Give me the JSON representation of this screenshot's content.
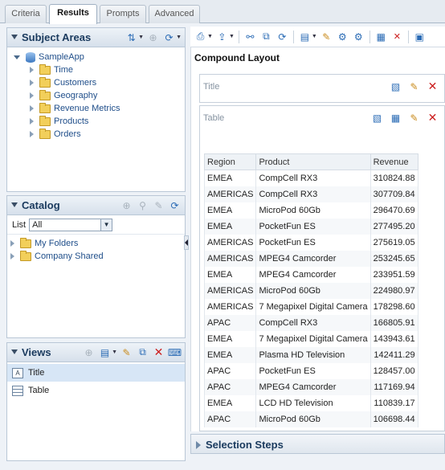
{
  "tabs": [
    {
      "label": "Criteria"
    },
    {
      "label": "Results"
    },
    {
      "label": "Prompts"
    },
    {
      "label": "Advanced"
    }
  ],
  "active_tab": "Results",
  "subject_areas": {
    "title": "Subject Areas",
    "root": "SampleApp",
    "folders": [
      "Time",
      "Customers",
      "Geography",
      "Revenue Metrics",
      "Products",
      "Orders"
    ]
  },
  "catalog": {
    "title": "Catalog",
    "list_label": "List",
    "list_selected": "All",
    "folders": [
      "My Folders",
      "Company Shared"
    ]
  },
  "views": {
    "title": "Views",
    "items": [
      {
        "label": "Title",
        "icon": "title-view-icon"
      },
      {
        "label": "Table",
        "icon": "table-view-icon"
      }
    ]
  },
  "layout": {
    "title": "Compound Layout",
    "title_view_label": "Title",
    "table_view_label": "Table"
  },
  "table": {
    "columns": [
      "Region",
      "Product",
      "Revenue"
    ],
    "rows": [
      [
        "EMEA",
        "CompCell RX3",
        "310824.88"
      ],
      [
        "AMERICAS",
        "CompCell RX3",
        "307709.84"
      ],
      [
        "EMEA",
        "MicroPod 60Gb",
        "296470.69"
      ],
      [
        "EMEA",
        "PocketFun ES",
        "277495.20"
      ],
      [
        "AMERICAS",
        "PocketFun ES",
        "275619.05"
      ],
      [
        "AMERICAS",
        "MPEG4 Camcorder",
        "253245.65"
      ],
      [
        "EMEA",
        "MPEG4 Camcorder",
        "233951.59"
      ],
      [
        "AMERICAS",
        "MicroPod 60Gb",
        "224980.97"
      ],
      [
        "AMERICAS",
        "7 Megapixel Digital Camera",
        "178298.60"
      ],
      [
        "APAC",
        "CompCell RX3",
        "166805.91"
      ],
      [
        "EMEA",
        "7 Megapixel Digital Camera",
        "143943.61"
      ],
      [
        "EMEA",
        "Plasma HD Television",
        "142411.29"
      ],
      [
        "APAC",
        "PocketFun ES",
        "128457.00"
      ],
      [
        "APAC",
        "MPEG4 Camcorder",
        "117169.94"
      ],
      [
        "EMEA",
        "LCD HD Television",
        "110839.17"
      ],
      [
        "APAC",
        "MicroPod 60Gb",
        "106698.44"
      ]
    ]
  },
  "selection_steps": {
    "label": "Selection Steps"
  },
  "colors": {
    "accent": "#1a3a5e",
    "link": "#1f4e8a",
    "delete": "#cc1f1f"
  }
}
